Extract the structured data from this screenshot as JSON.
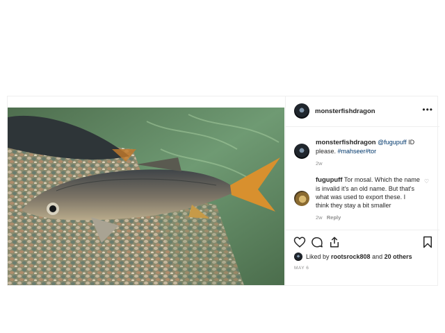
{
  "post": {
    "owner": "monsterfishdragon",
    "more_icon": "more-icon"
  },
  "caption": {
    "username": "monsterfishdragon",
    "mention": "@fugupuff",
    "text": " ID please. ",
    "hashtag1": "#mahseer",
    "hashtag2": "#tor",
    "time": "2w"
  },
  "comment": {
    "username": "fugupuff",
    "text": " Tor mosal. Which the name is invalid it's an old name. But that's what was used to export these. I think they stay a bit smaller",
    "time": "2w",
    "reply": "Reply"
  },
  "likes": {
    "prefix": "Liked by ",
    "user": "rootsrock808",
    "middle": " and ",
    "count": "20 others"
  },
  "date": "MAY 6"
}
